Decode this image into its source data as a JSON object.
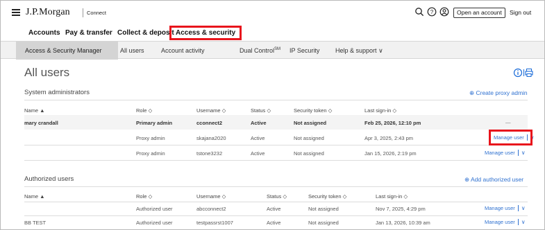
{
  "header": {
    "brand": "J.P.Morgan",
    "brand_sub": "Connect",
    "open_account": "Open an account",
    "sign_out": "Sign out",
    "icons": [
      "search-icon",
      "help-icon",
      "profile-icon"
    ]
  },
  "primary_nav": [
    "Accounts",
    "Pay & transfer",
    "Collect & deposit",
    "Access & security"
  ],
  "secondary_nav": {
    "items": [
      "Access & Security Manager",
      "All users",
      "Account activity",
      "Dual Control",
      "IP Security",
      "Help & support"
    ],
    "dual_sup": "SM",
    "help_chevron": "∨"
  },
  "page": {
    "title": "All users",
    "title_icons": "ⓘ|🖶"
  },
  "sysadmin": {
    "title": "System administrators",
    "action": "⊕ Create proxy admin",
    "columns": [
      "Name ▲",
      "Role ◇",
      "Username ◇",
      "Status ◇",
      "Security token ◇",
      "Last sign-in ◇"
    ],
    "rows": [
      {
        "name": "mary crandall",
        "role": "Primary admin",
        "username": "cconnect2",
        "status": "Active",
        "token": "Not assigned",
        "last": "Feb 25, 2026, 12:10 pm",
        "action": "—"
      },
      {
        "name": "",
        "role": "Proxy admin",
        "username": "skajana2020",
        "status": "Active",
        "token": "Not assigned",
        "last": "Apr 3, 2025, 2:43 pm",
        "action": "Manage user"
      },
      {
        "name": "",
        "role": "Proxy admin",
        "username": "tstone3232",
        "status": "Active",
        "token": "Not assigned",
        "last": "Jan 15, 2026, 2:19 pm",
        "action": "Manage user"
      }
    ]
  },
  "authorized": {
    "title": "Authorized users",
    "action": "⊕ Add authorized user",
    "columns": [
      "Name ▲",
      "Role ◇",
      "Username ◇",
      "Status ◇",
      "Security token ◇",
      "Last sign-in ◇"
    ],
    "rows": [
      {
        "name": "",
        "role": "Authorized user",
        "username": "abcconnect2",
        "status": "Active",
        "token": "Not assigned",
        "last": "Nov 7, 2025, 4:29 pm",
        "action": "Manage user"
      },
      {
        "name": "BB TEST",
        "role": "Authorized user",
        "username": "testpassrst1007",
        "status": "Active",
        "token": "Not assigned",
        "last": "Jan 13, 2026, 10:39 am",
        "action": "Manage user"
      }
    ]
  },
  "chevron": "∨",
  "colors": {
    "accent": "#2f71d0",
    "highlight": "#e8141c"
  }
}
